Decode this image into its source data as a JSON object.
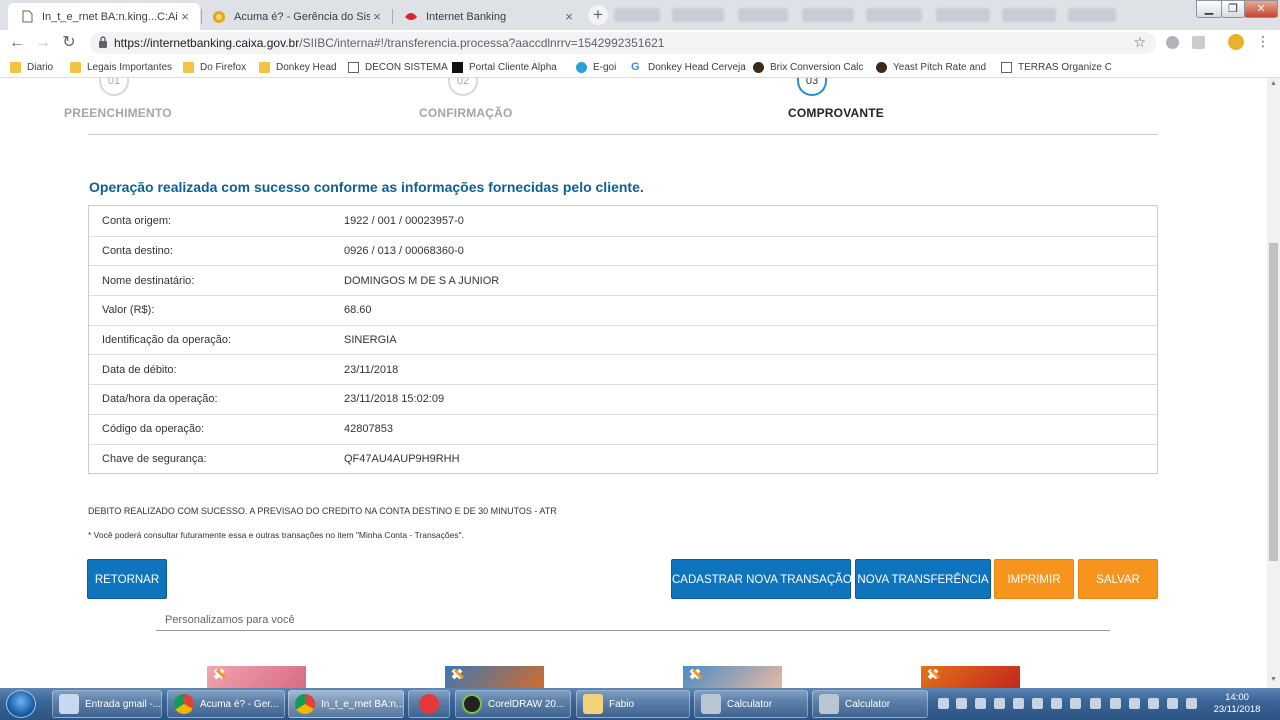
{
  "browser": {
    "tabs": [
      {
        "title": "In_t_e_rnet BA:n.king...C:AiXA",
        "active": true
      },
      {
        "title": "Acuma é? - Gerência do Sistema",
        "active": false
      },
      {
        "title": "Internet Banking",
        "active": false
      }
    ],
    "new_tab": "+",
    "url_host": "https://internetbanking.caixa.gov.br",
    "url_path": "/SIIBC/interna#!/transferencia.processa?aaccdlnrrv=1542992351621",
    "bookmarks": [
      "Diario",
      "Legais Importantes",
      "Do Firefox",
      "Donkey Head",
      "DECON SISTEMA",
      "Portal Cliente Alpha",
      "E-goi",
      "Donkey Head Cerveja",
      "Brix Conversion Calcu",
      "Yeast Pitch Rate and",
      "TERRAS Organize Co"
    ]
  },
  "steps": [
    {
      "number": "01",
      "label": "PREENCHIMENTO"
    },
    {
      "number": "02",
      "label": "CONFIRMAÇÃO"
    },
    {
      "number": "03",
      "label": "COMPROVANTE"
    }
  ],
  "success_message": "Operação realizada com sucesso conforme as informações fornecidas pelo cliente.",
  "receipt": [
    {
      "label": "Conta origem:",
      "value": "1922 / 001 / 00023957-0"
    },
    {
      "label": "Conta destino:",
      "value": "0926 / 013 / 00068360-0"
    },
    {
      "label": "Nome destinatário:",
      "value": "DOMINGOS M DE S A JUNIOR"
    },
    {
      "label": "Valor (R$):",
      "value": "68.60"
    },
    {
      "label": "Identificação da operação:",
      "value": "SINERGIA"
    },
    {
      "label": "Data de débito:",
      "value": "23/11/2018"
    },
    {
      "label": "Data/hora da operação:",
      "value": "23/11/2018 15:02:09"
    },
    {
      "label": "Código da operação:",
      "value": "42807853"
    },
    {
      "label": "Chave de segurança:",
      "value": "QF47AU4AUP9H9RHH"
    }
  ],
  "notice": "DEBITO REALIZADO COM SUCESSO. A PREVISAO DO CREDITO NA CONTA DESTINO E DE 30 MINUTOS - ATR",
  "footnote": "* Você poderá consultar futuramente essa e outras transações no item \"Minha Conta - Transações\".",
  "buttons": {
    "retornar": "RETORNAR",
    "cadastrar": "CADASTRAR NOVA TRANSAÇÃO",
    "nova": "NOVA TRANSFERÊNCIA",
    "imprimir": "IMPRIMIR",
    "salvar": "SALVAR"
  },
  "personalized_title": "Personalizamos para você",
  "taskbar": {
    "items": [
      "Entrada gmail -...",
      "Acuma é? - Ger...",
      "In_t_e_rnet BA:n...",
      "CorelDRAW 20...",
      "Fabio",
      "Calculator",
      "Calculator"
    ],
    "time": "14:00",
    "date": "23/11/2018"
  },
  "colors": {
    "brand_blue": "#0e74bd",
    "brand_orange": "#f7941d",
    "success_text": "#0d5f95"
  }
}
